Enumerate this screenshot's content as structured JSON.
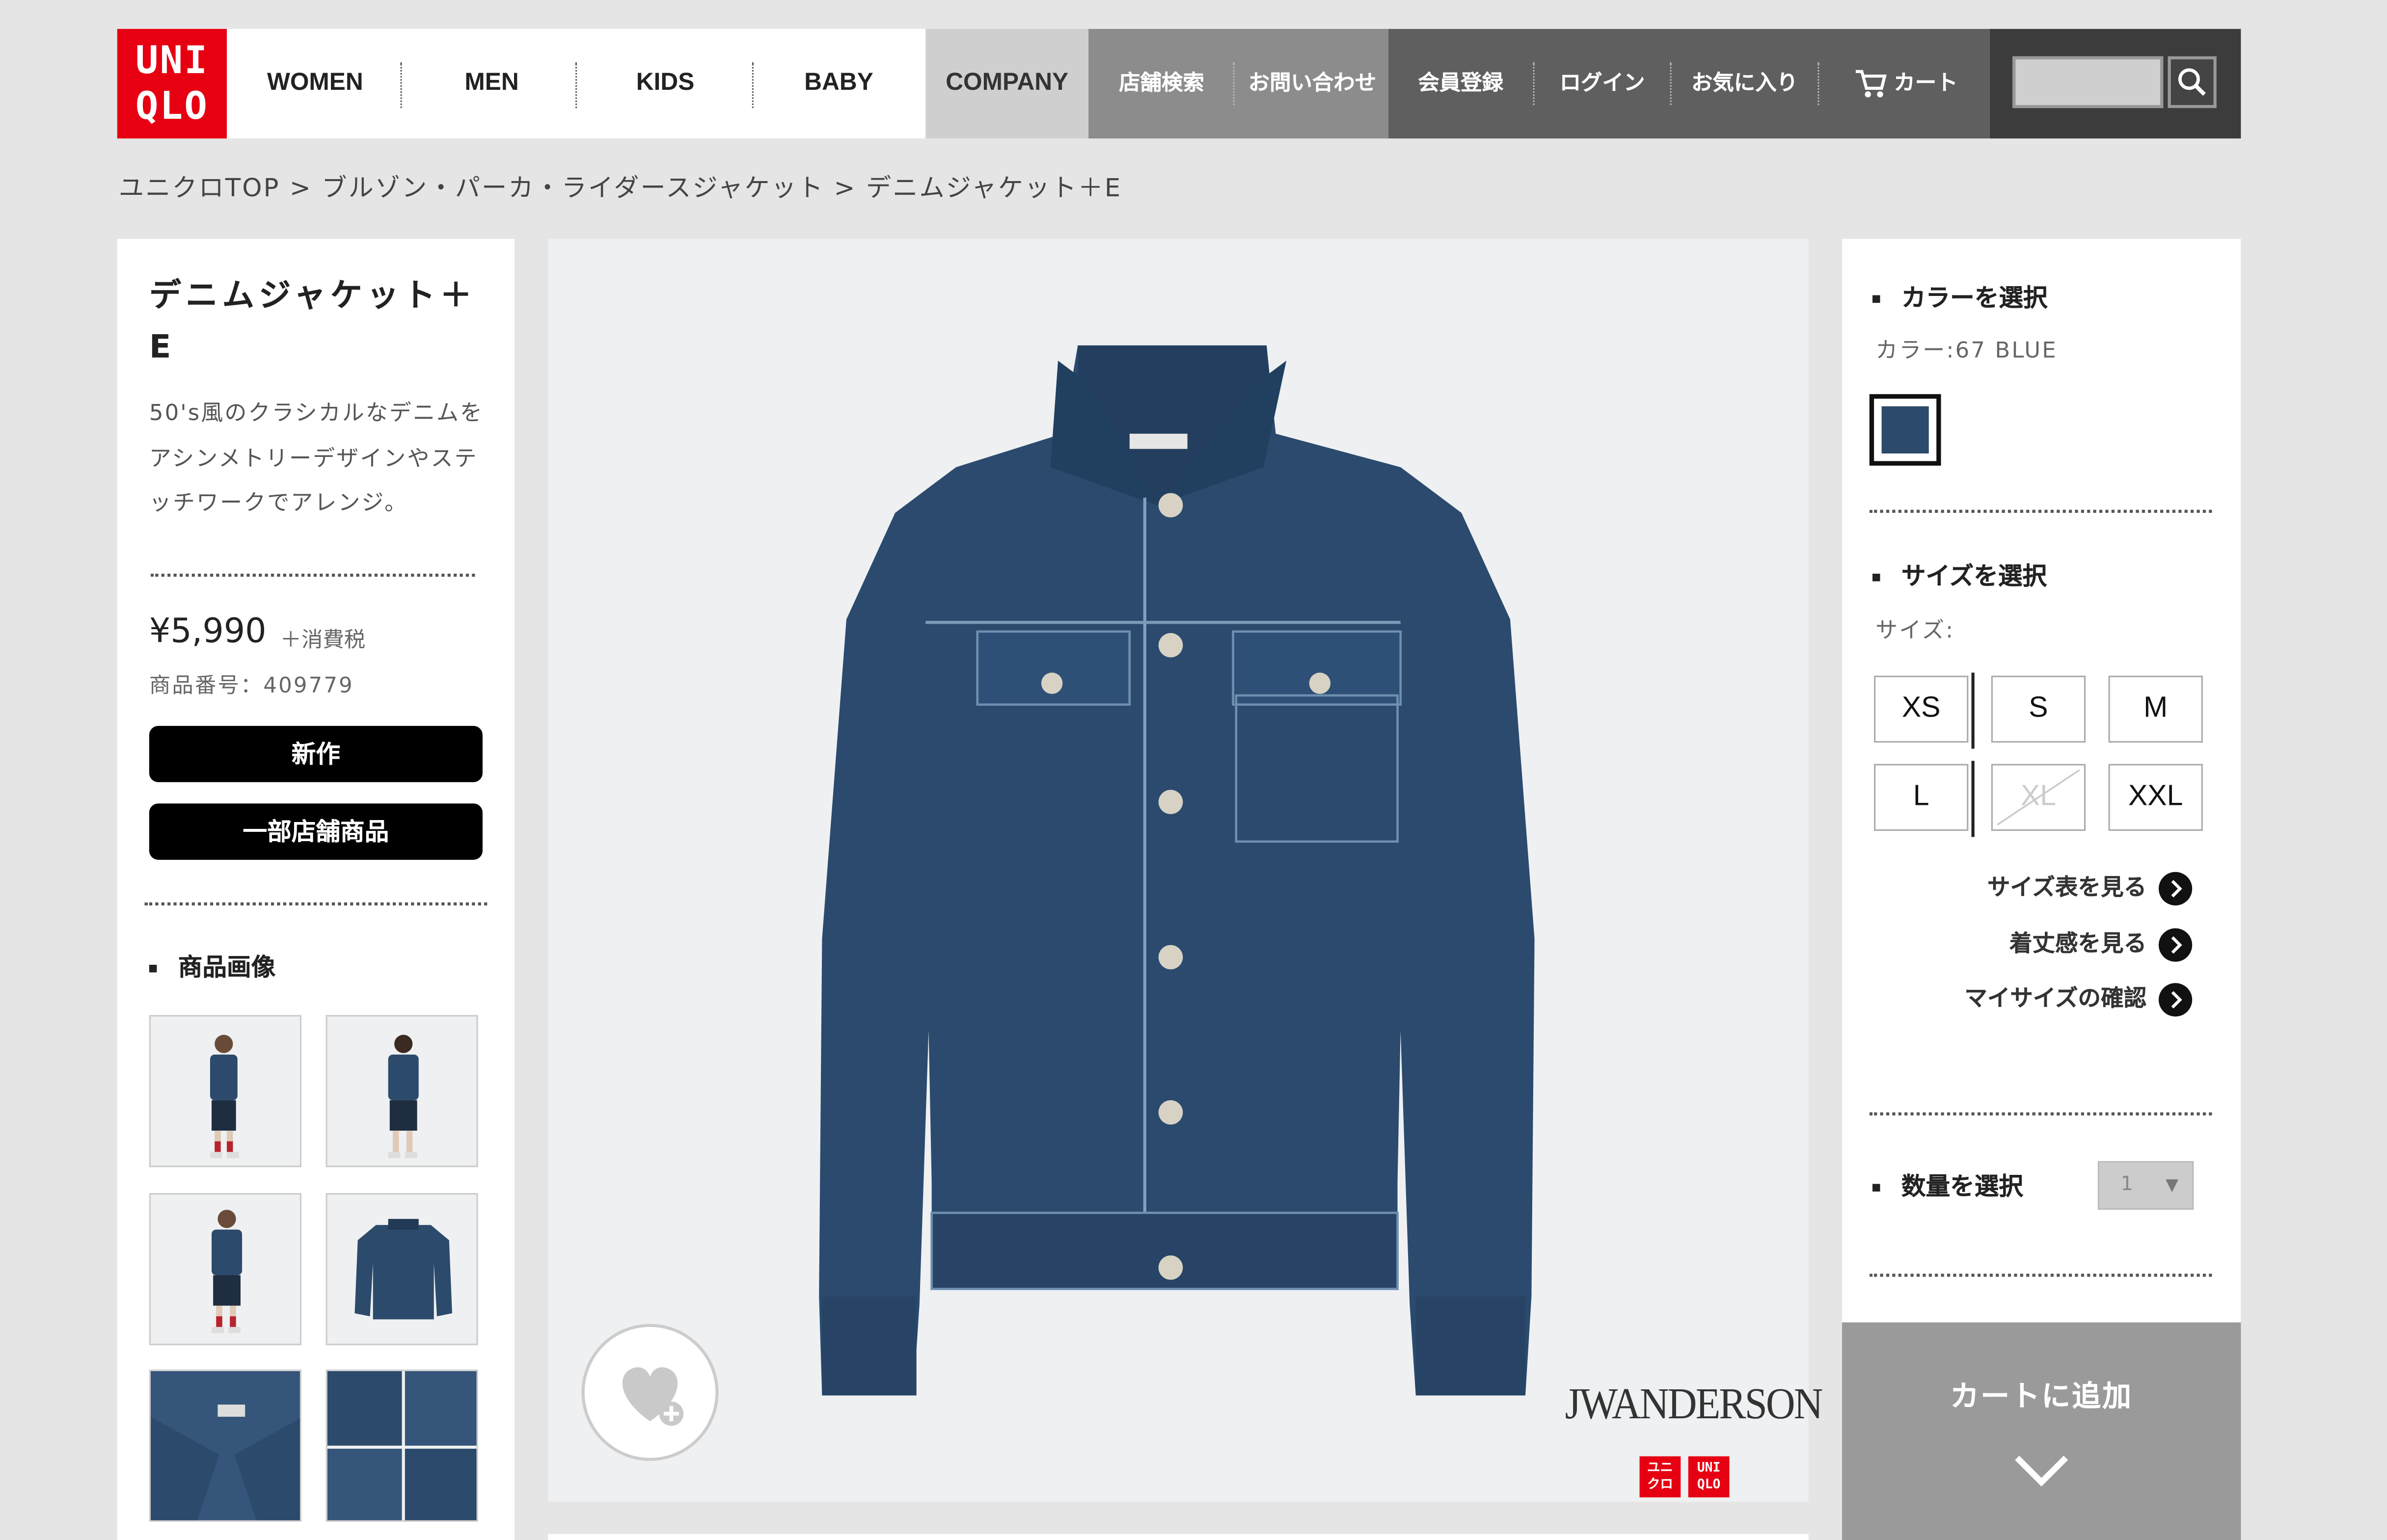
{
  "header": {
    "logo": [
      "UNI",
      "QLO"
    ],
    "categories": [
      "WOMEN",
      "MEN",
      "KIDS",
      "BABY"
    ],
    "company": "COMPANY",
    "utility": [
      "店舗検索",
      "お問い合わせ",
      "会員登録",
      "ログイン",
      "お気に入り",
      "カート"
    ],
    "search": {
      "placeholder": ""
    }
  },
  "breadcrumb": {
    "items": [
      "ユニクロTOP",
      "ブルゾン・パーカ・ライダースジャケット",
      "デニムジャケット＋E"
    ],
    "separator": ">"
  },
  "product": {
    "title": "デニムジャケット＋E",
    "description": "50's風のクラシカルなデニムをアシンメトリーデザインやステッチワークでアレンジ。",
    "price": "¥5,990",
    "tax": "＋消費税",
    "number": "商品番号：409779",
    "badges": [
      "新作",
      "一部店舗商品"
    ],
    "images_heading": "商品画像"
  },
  "main_image": {
    "brand": "JWANDERSON",
    "logo_small": [
      "ユニ",
      "クロ"
    ],
    "logo_small_en": [
      "UNI",
      "QLO"
    ]
  },
  "options": {
    "color_heading": "カラーを選択",
    "color_value": "カラー:67 BLUE",
    "size_heading": "サイズを選択",
    "size_label": "サイズ:",
    "sizes": [
      "XS",
      "S",
      "M",
      "L",
      "XL",
      "XXL"
    ],
    "size_chart": "サイズ表を見る",
    "fit_check": "着丈感を見る",
    "mysize": "マイサイズの確認",
    "qty_heading": "数量を選択",
    "qty_value": "1",
    "add_to_cart": "カートに追加"
  },
  "colors": {
    "brand_red": "#e60012",
    "denim": "#2c4a6b",
    "cart_button": "#9a9a9a"
  }
}
